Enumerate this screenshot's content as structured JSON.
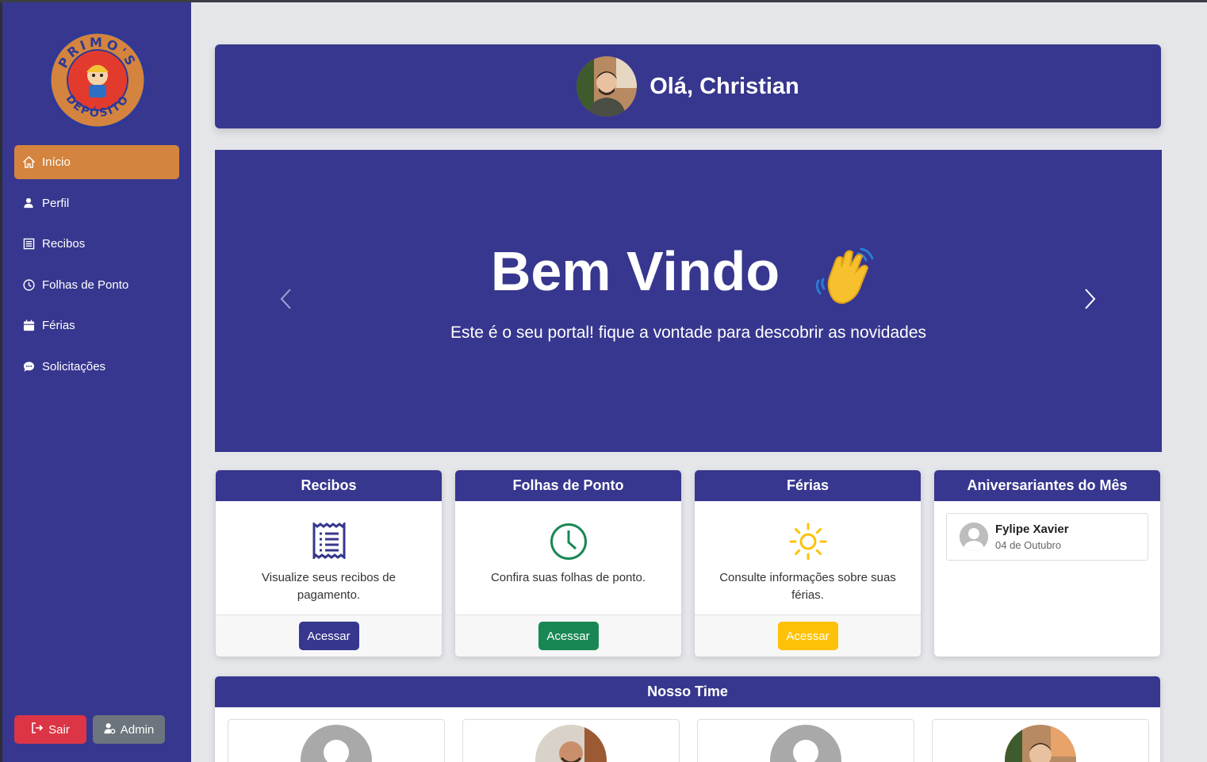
{
  "brand": {
    "logo_top": "PRIMO'S",
    "logo_bottom": "DEPÓSITO"
  },
  "sidebar": {
    "items": [
      {
        "label": "Início",
        "icon": "home-icon"
      },
      {
        "label": "Perfil",
        "icon": "user-icon"
      },
      {
        "label": "Recibos",
        "icon": "receipt-icon"
      },
      {
        "label": "Folhas de Ponto",
        "icon": "clock-icon"
      },
      {
        "label": "Férias",
        "icon": "calendar-icon"
      },
      {
        "label": "Solicitações",
        "icon": "chat-icon"
      }
    ],
    "logout_label": "Sair",
    "admin_label": "Admin"
  },
  "header": {
    "greeting": "Olá, Christian"
  },
  "carousel": {
    "title": "Bem Vindo",
    "subtitle": "Este é o seu portal! fique a vontade para descobrir as novidades"
  },
  "cards": [
    {
      "title": "Recibos",
      "text": "Visualize seus recibos de pagamento.",
      "button": "Acessar",
      "color": "#37378f"
    },
    {
      "title": "Folhas de Ponto",
      "text": "Confira suas folhas de ponto.",
      "button": "Acessar",
      "color": "#198754"
    },
    {
      "title": "Férias",
      "text": "Consulte informações sobre suas férias.",
      "button": "Acessar",
      "color": "#ffc107"
    }
  ],
  "birthdays": {
    "title": "Aniversariantes do Mês",
    "items": [
      {
        "name": "Fylipe Xavier",
        "date": "04 de Outubro"
      }
    ]
  },
  "team": {
    "title": "Nosso Time"
  },
  "colors": {
    "primary": "#37378f",
    "accent": "#d4843e",
    "danger": "#dc3545",
    "secondary": "#6c757d"
  }
}
